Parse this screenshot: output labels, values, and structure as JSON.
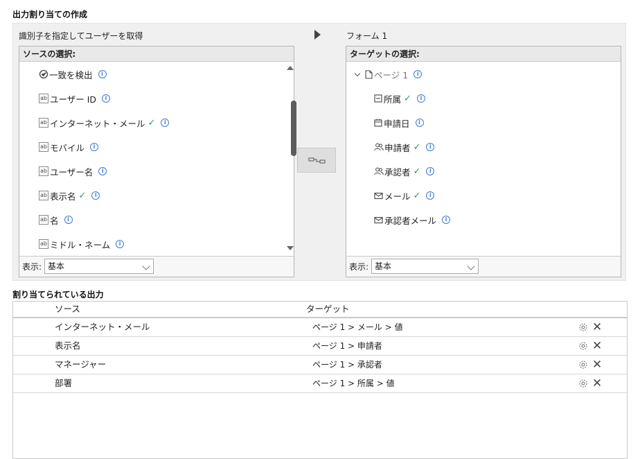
{
  "page": {
    "title": "出力割り当ての作成"
  },
  "source_panel": {
    "label": "識別子を指定してユーザーを取得",
    "header": "ソースの選択:",
    "items": [
      {
        "label": "一致を検出",
        "icon": "match-icon",
        "checked": false
      },
      {
        "label": "ユーザー ID",
        "icon": "text-field-icon",
        "checked": false
      },
      {
        "label": "インターネット・メール",
        "icon": "text-field-icon",
        "checked": true
      },
      {
        "label": "モバイル",
        "icon": "text-field-icon",
        "checked": false
      },
      {
        "label": "ユーザー名",
        "icon": "text-field-icon",
        "checked": false
      },
      {
        "label": "表示名",
        "icon": "text-field-icon",
        "checked": true
      },
      {
        "label": "名",
        "icon": "text-field-icon",
        "checked": false
      },
      {
        "label": "ミドル・ネーム",
        "icon": "text-field-icon",
        "checked": false
      }
    ],
    "view_label": "表示:",
    "view_value": "基本"
  },
  "target_panel": {
    "label": "フォーム 1",
    "header": "ターゲットの選択:",
    "page_node": "ページ 1",
    "items": [
      {
        "label": "所属",
        "icon": "dropdown-field-icon",
        "checked": true
      },
      {
        "label": "申請日",
        "icon": "calendar-icon",
        "checked": false
      },
      {
        "label": "申請者",
        "icon": "people-icon",
        "checked": true
      },
      {
        "label": "承認者",
        "icon": "people-icon",
        "checked": true
      },
      {
        "label": "メール",
        "icon": "mail-icon",
        "checked": true
      },
      {
        "label": "承認者メール",
        "icon": "mail-icon",
        "checked": false
      }
    ],
    "view_label": "表示:",
    "view_value": "基本"
  },
  "info_glyph": "i",
  "ab_glyph": "ab",
  "check_glyph": "✓",
  "assigned": {
    "title": "割り当てられている出力",
    "col_source": "ソース",
    "col_target": "ターゲット",
    "rows": [
      {
        "source": "インターネット・メール",
        "target": "ページ 1 > メール > 値"
      },
      {
        "source": "表示名",
        "target": "ページ 1 > 申請者"
      },
      {
        "source": "マネージャー",
        "target": "ページ 1 > 承認者"
      },
      {
        "source": "部署",
        "target": "ページ 1 > 所属 > 値"
      }
    ],
    "close_glyph": "✕"
  }
}
